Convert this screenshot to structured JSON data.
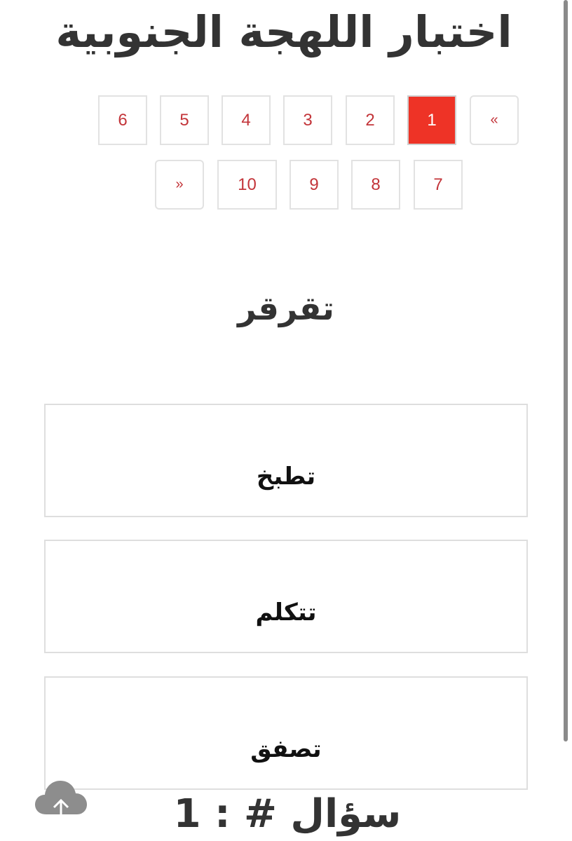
{
  "page_title": "اختبار اللهجة الجنوبية",
  "pagination": {
    "row1": [
      {
        "label": "«",
        "type": "prev"
      },
      {
        "label": "1",
        "active": true
      },
      {
        "label": "2"
      },
      {
        "label": "3"
      },
      {
        "label": "4"
      },
      {
        "label": "5"
      },
      {
        "label": "6"
      }
    ],
    "row2": [
      {
        "label": "7"
      },
      {
        "label": "8"
      },
      {
        "label": "9"
      },
      {
        "label": "10"
      },
      {
        "label": "»",
        "type": "next"
      }
    ]
  },
  "question": {
    "word": "تقرقر",
    "options": [
      "تطبخ",
      "تتكلم",
      "تصفق"
    ],
    "counter": "سؤال # : 1"
  },
  "colors": {
    "accent": "#ee3326",
    "page_text": "#c3353a",
    "border": "#e2e2e2"
  },
  "icons": {
    "upload": "cloud-upload-icon"
  }
}
